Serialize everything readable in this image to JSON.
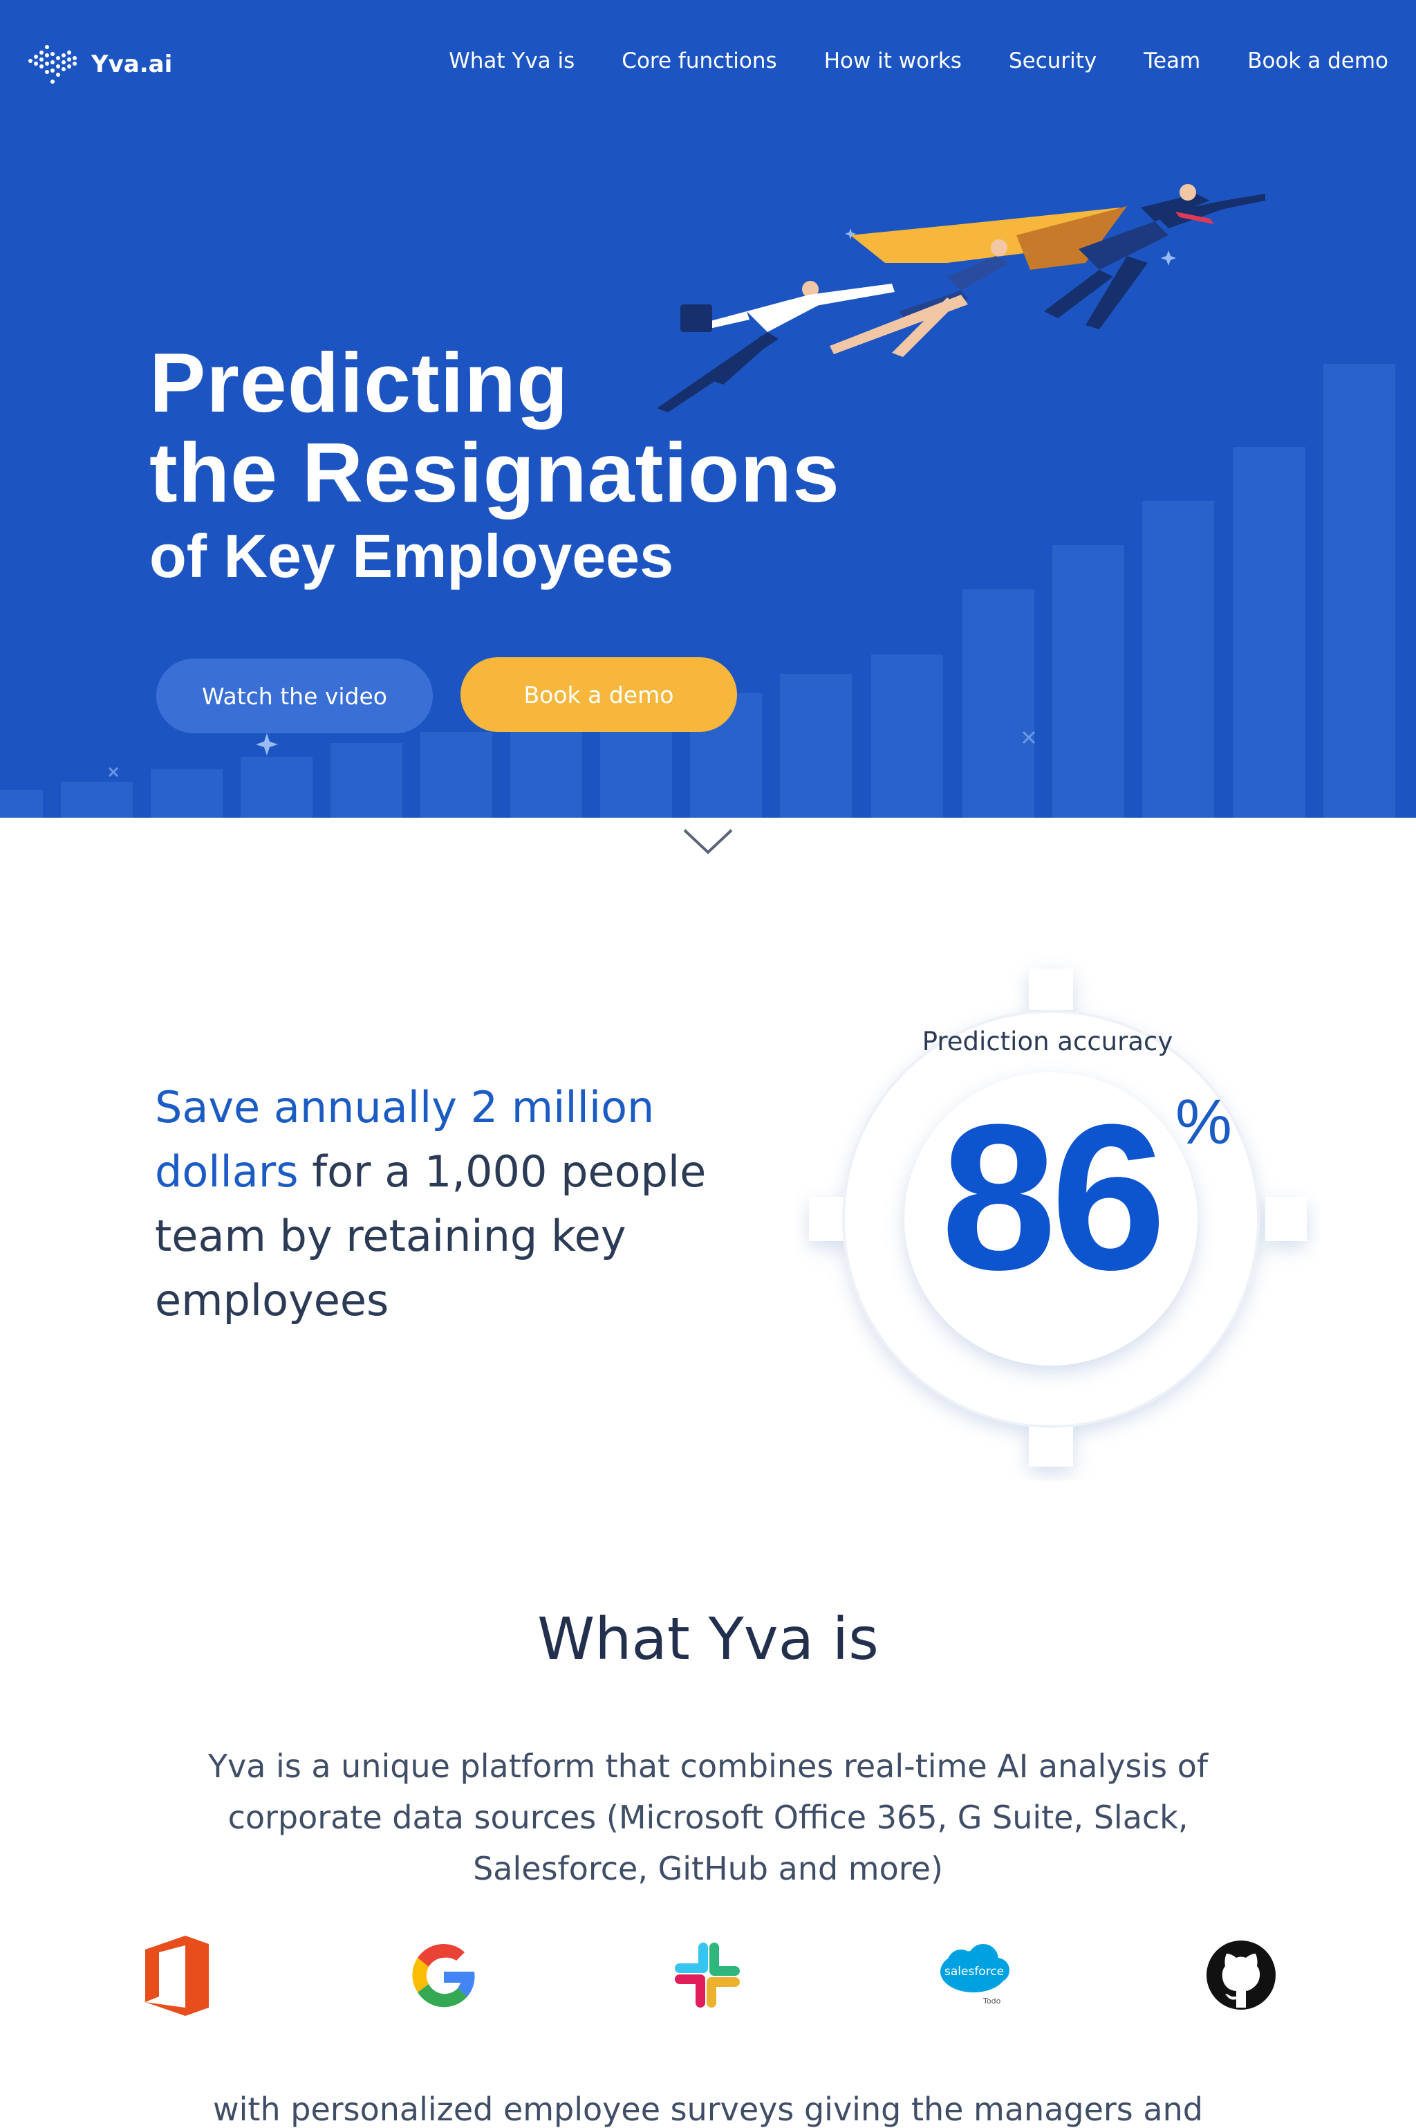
{
  "brand": {
    "name": "Yva.ai"
  },
  "nav": {
    "items": [
      "What Yva is",
      "Core functions",
      "How it works",
      "Security",
      "Team",
      "Book a demo"
    ]
  },
  "hero": {
    "title_line1": "Predicting",
    "title_line2": "the Resignations",
    "title_line3": "of Key Employees",
    "watch_video_label": "Watch the video",
    "book_demo_label": "Book a demo"
  },
  "stats": {
    "text_highlight": "Save annually 2 million dollars",
    "text_rest": " for a 1,000 people team by retaining key employees",
    "accuracy_label": "Prediction accuracy",
    "accuracy_value": "86",
    "accuracy_unit": "%"
  },
  "what_yva": {
    "title": "What Yva is",
    "description": "Yva is a unique platform that combines real-time AI analysis of corporate data sources (Microsoft Office 365, G Suite, Slack, Salesforce, GitHub and more)",
    "integrations": [
      {
        "name": "Microsoft Office 365",
        "icon": "office365-icon"
      },
      {
        "name": "G Suite",
        "icon": "google-icon"
      },
      {
        "name": "Slack",
        "icon": "slack-icon"
      },
      {
        "name": "Salesforce",
        "icon": "salesforce-icon",
        "logo_text": "salesforce",
        "sub_text": "Todo"
      },
      {
        "name": "GitHub",
        "icon": "github-icon"
      }
    ],
    "continuation": "with personalized employee surveys giving the managers and"
  },
  "colors": {
    "hero_bg": "#1c55c1",
    "accent_yellow": "#f6b73c",
    "accent_blue": "#0d54cf"
  }
}
